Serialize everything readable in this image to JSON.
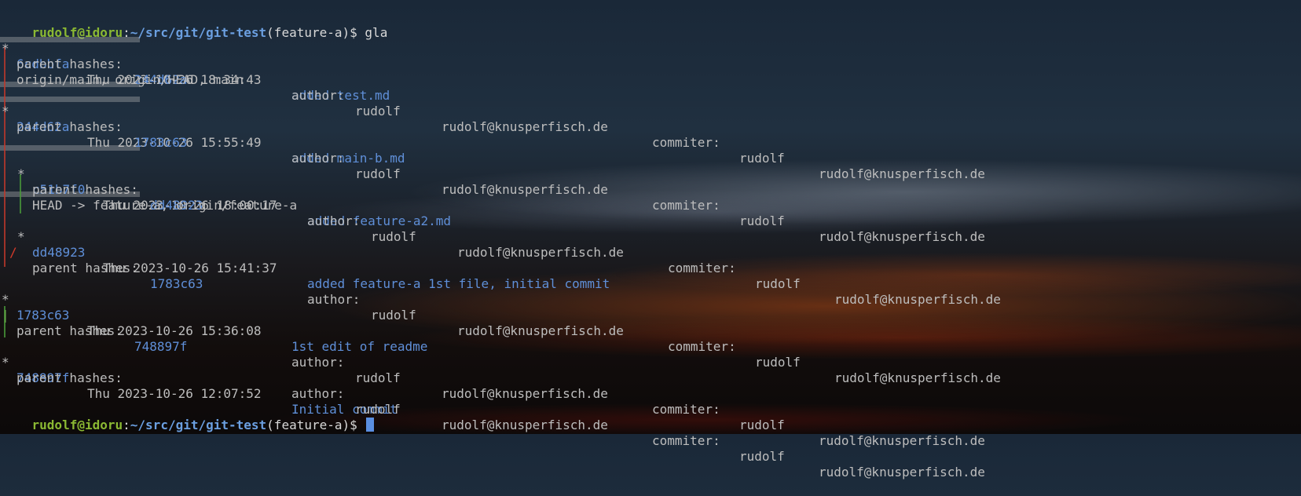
{
  "prompt": {
    "user": "rudolf",
    "at": "@",
    "host": "idoru",
    "colon": ":",
    "path": "~/src/git/git-test",
    "branch": "(feature-a)",
    "dollar": "$",
    "command": "gla"
  },
  "labels": {
    "parent": "parent hashes:",
    "author": "author:",
    "commiter": "commiter:"
  },
  "commits": [
    {
      "graph": "*",
      "hash": "6cdbbfa",
      "date": "Thu 2023-10-26 18:34:43",
      "message": "added test.md",
      "parent": "244d62a",
      "author": "rudolf",
      "author_email": "rudolf@knusperfisch.de",
      "commiter": "rudolf",
      "commiter_email": "rudolf@knusperfisch.de",
      "refs": "origin/main, origin/HEAD, main"
    },
    {
      "graph": "*",
      "hash": "244d62a",
      "date": "Thu 2023-10-26 15:55:49",
      "message": "added main-b.md",
      "parent": "1783c63",
      "author": "rudolf",
      "author_email": "rudolf@knusperfisch.de",
      "commiter": "rudolf",
      "commiter_email": "rudolf@knusperfisch.de",
      "refs": ""
    },
    {
      "graph": "*",
      "hash": "c51b7f0",
      "date": "Thu 2023-10-26 18:00:17",
      "message": "added feature-a2.md",
      "parent": "dd48923",
      "author": "rudolf",
      "author_email": "rudolf@knusperfisch.de",
      "commiter": "rudolf",
      "commiter_email": "rudolf@knusperfisch.de",
      "refs": "HEAD -> feature-a, origin/feature-a"
    },
    {
      "graph": "*",
      "hash": "dd48923",
      "date": "Thu 2023-10-26 15:41:37",
      "message": "added feature-a 1st file, initial commit",
      "parent": "1783c63",
      "author": "rudolf",
      "author_email": "rudolf@knusperfisch.de",
      "commiter": "rudolf",
      "commiter_email": "rudolf@knusperfisch.de",
      "refs": ""
    },
    {
      "graph": "*",
      "hash": "1783c63",
      "date": "Thu 2023-10-26 15:36:08",
      "message": "1st edit of readme",
      "parent": "748897f",
      "author": "rudolf",
      "author_email": "rudolf@knusperfisch.de",
      "commiter": "rudolf",
      "commiter_email": "rudolf@knusperfisch.de",
      "refs": ""
    },
    {
      "graph": "*",
      "hash": "748897f",
      "date": "Thu 2023-10-26 12:07:52",
      "message": "Initial commit",
      "parent": "",
      "author": "rudolf",
      "author_email": "rudolf@knusperfisch.de",
      "commiter": "rudolf",
      "commiter_email": "rudolf@knusperfisch.de",
      "refs": ""
    }
  ],
  "graph": {
    "merge_slash": "/",
    "pipe": "|"
  },
  "colors": {
    "prompt_user": "#8ab833",
    "prompt_path": "#6b9fe0",
    "hash": "#5f8fd8",
    "graph_main": "#d63a2a",
    "graph_branch": "#6ab04c"
  }
}
